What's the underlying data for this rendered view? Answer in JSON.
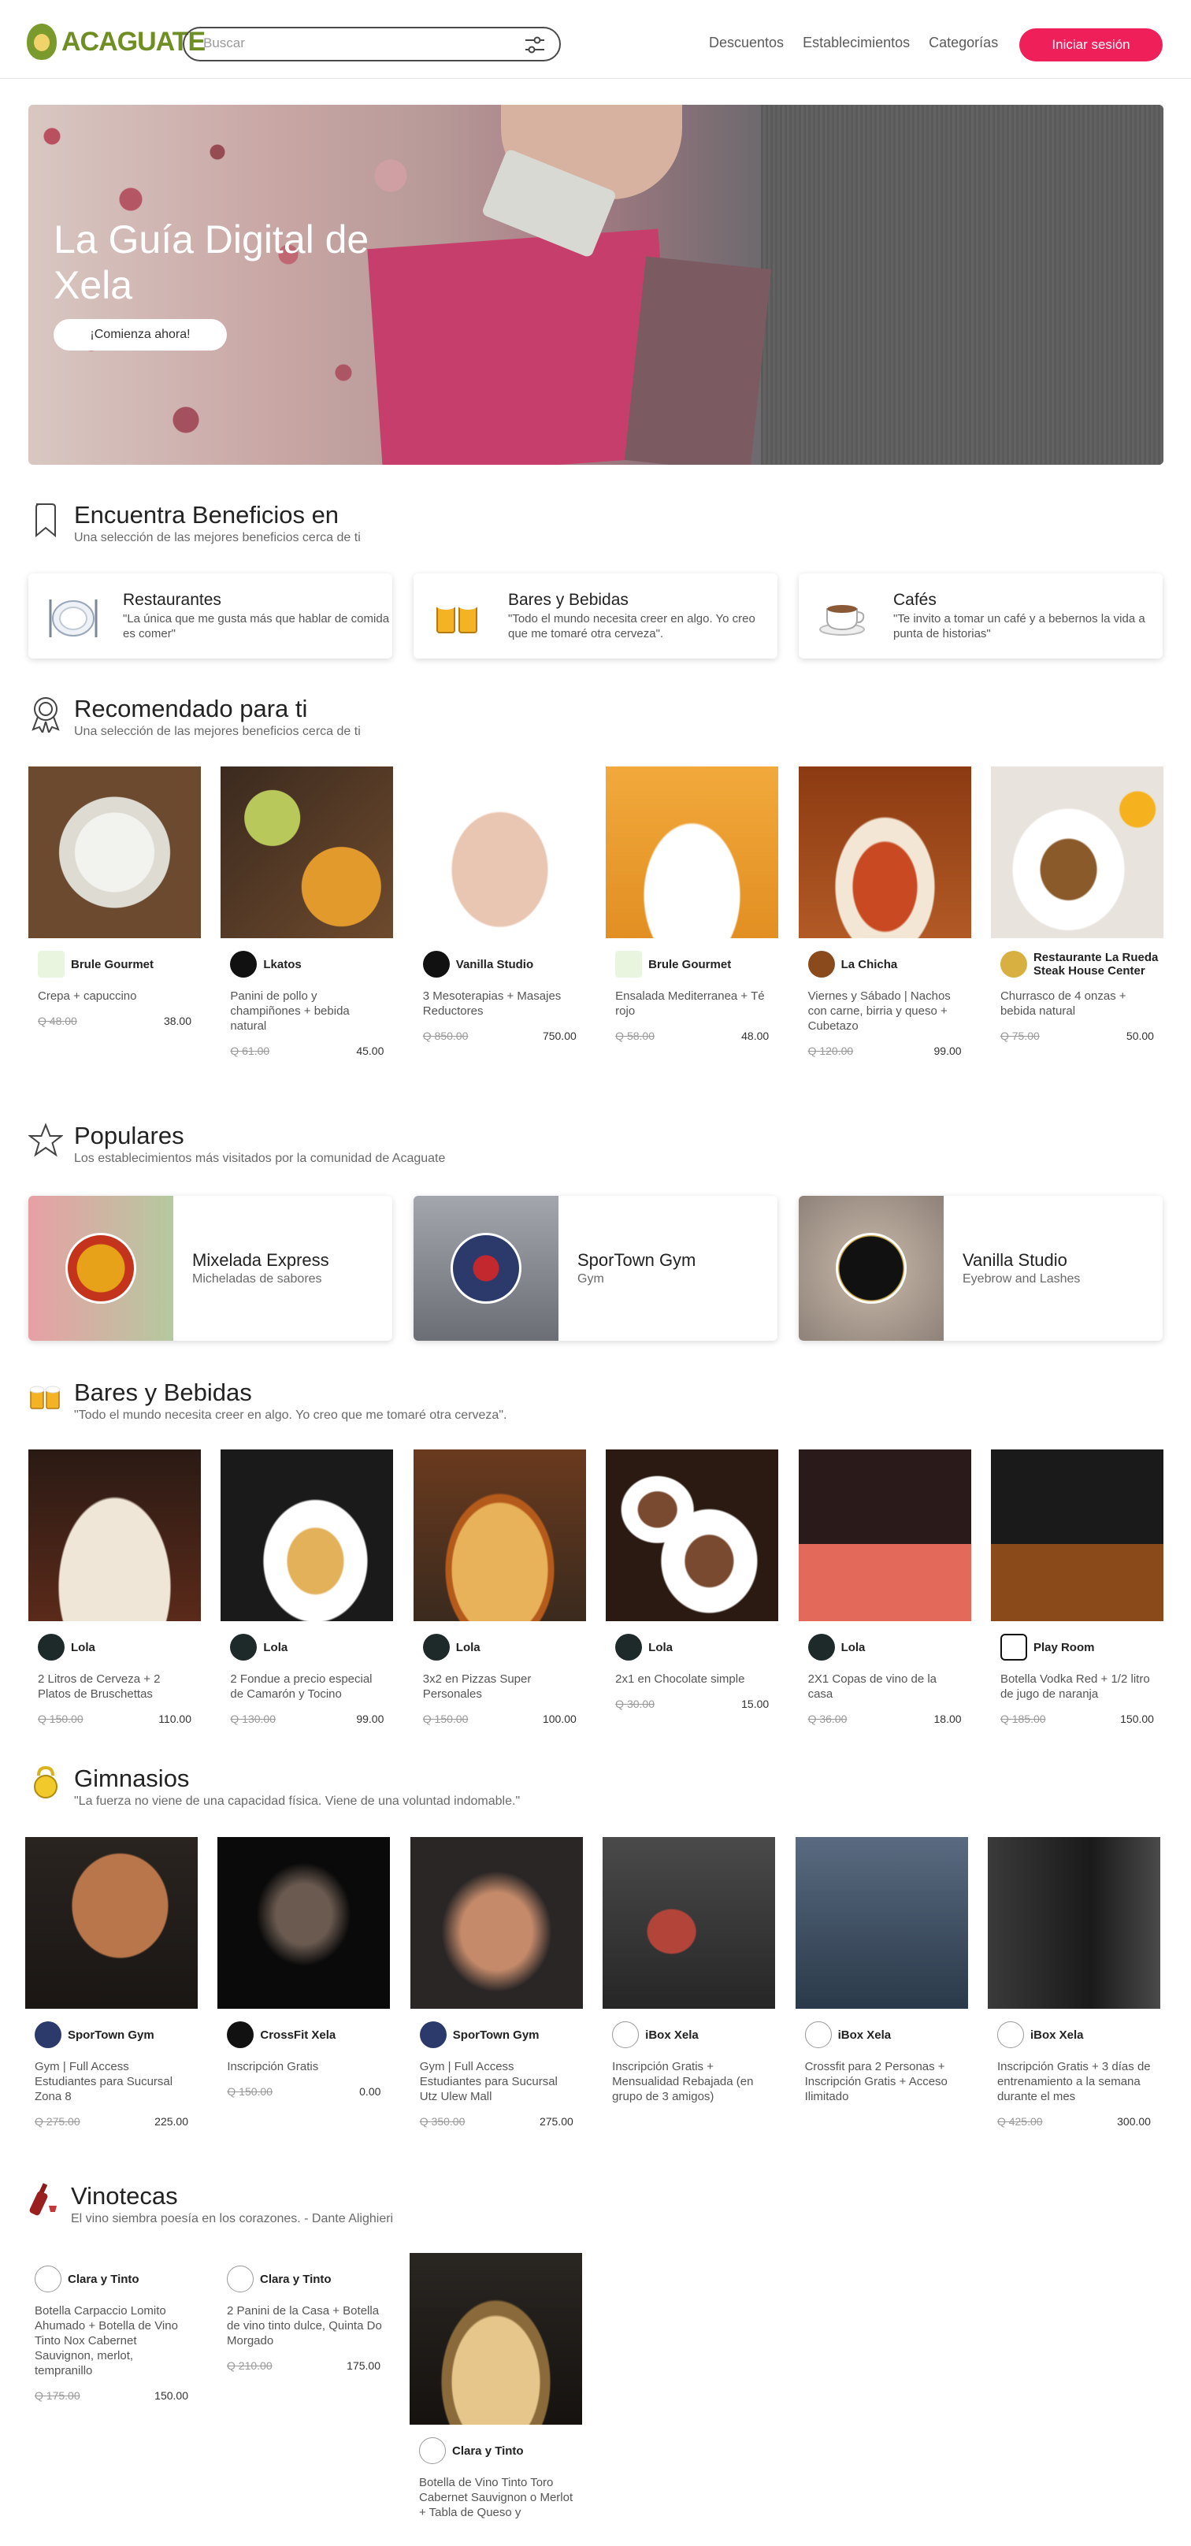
{
  "nav": {
    "brand": "ACAGUATE",
    "search_placeholder": "Buscar",
    "links": [
      "Descuentos",
      "Establecimientos",
      "Categorías"
    ],
    "login": "Iniciar sesión"
  },
  "hero": {
    "title": "La Guía Digital de Xela",
    "cta": "¡Comienza ahora!"
  },
  "benefits": {
    "title": "Encuentra Beneficios en",
    "subtitle": "Una selección de las mejores beneficios cerca de ti",
    "categories": [
      {
        "name": "Restaurantes",
        "desc": "\"La única que me gusta más que hablar de comida es comer\""
      },
      {
        "name": "Bares y Bebidas",
        "desc": "\"Todo el mundo necesita creer en algo. Yo creo que me tomaré otra cerveza\"."
      },
      {
        "name": "Cafés",
        "desc": "\"Te invito a tomar un café y a bebernos la vida a punta de historias\""
      }
    ]
  },
  "recommended": {
    "title": "Recomendado para ti",
    "subtitle": "Una selección de las mejores beneficios cerca de ti",
    "items": [
      {
        "biz": "Brule Gourmet",
        "desc": "Crepa + capuccino",
        "old": "Q 48.00",
        "new": "38.00"
      },
      {
        "biz": "Lkatos",
        "desc": "Panini de pollo y champiñones + bebida natural",
        "old": "Q 61.00",
        "new": "45.00"
      },
      {
        "biz": "Vanilla Studio",
        "desc": "3 Mesoterapias + Masajes Reductores",
        "old": "Q 850.00",
        "new": "750.00"
      },
      {
        "biz": "Brule Gourmet",
        "desc": "Ensalada Mediterranea + Té rojo",
        "old": "Q 58.00",
        "new": "48.00"
      },
      {
        "biz": "La Chicha",
        "desc": "Viernes y Sábado | Nachos con carne, birria y queso + Cubetazo",
        "old": "Q 120.00",
        "new": "99.00"
      },
      {
        "biz": "Restaurante La Rueda Steak House Center",
        "desc": "Churrasco de 4 onzas + bebida natural",
        "old": "Q 75.00",
        "new": "50.00"
      }
    ]
  },
  "popular": {
    "title": "Populares",
    "subtitle": "Los establecimientos más visitados por la comunidad de Acaguate",
    "items": [
      {
        "name": "Mixelada Express",
        "desc": "Micheladas de sabores"
      },
      {
        "name": "SporTown Gym",
        "desc": "Gym"
      },
      {
        "name": "Vanilla Studio",
        "desc": "Eyebrow and Lashes"
      }
    ]
  },
  "bars": {
    "title": "Bares y Bebidas",
    "subtitle": "\"Todo el mundo necesita creer en algo. Yo creo que me tomaré otra cerveza\".",
    "items": [
      {
        "biz": "Lola",
        "desc": "2 Litros de Cerveza + 2 Platos de Bruschettas",
        "old": "Q 150.00",
        "new": "110.00"
      },
      {
        "biz": "Lola",
        "desc": "2 Fondue a precio especial de Camarón y Tocino",
        "old": "Q 130.00",
        "new": "99.00"
      },
      {
        "biz": "Lola",
        "desc": "3x2 en Pizzas Super Personales",
        "old": "Q 150.00",
        "new": "100.00"
      },
      {
        "biz": "Lola",
        "desc": "2x1 en Chocolate simple",
        "old": "Q 30.00",
        "new": "15.00"
      },
      {
        "biz": "Lola",
        "desc": "2X1 Copas de vino de la casa",
        "old": "Q 36.00",
        "new": "18.00"
      },
      {
        "biz": "Play Room",
        "desc": "Botella Vodka Red + 1/2 litro de jugo de naranja",
        "old": "Q 185.00",
        "new": "150.00"
      }
    ]
  },
  "gyms": {
    "title": "Gimnasios",
    "subtitle": "\"La fuerza no viene de una capacidad física. Viene de una voluntad indomable.\"",
    "items": [
      {
        "biz": "SporTown Gym",
        "desc": "Gym | Full Access Estudiantes para Sucursal Zona 8",
        "old": "Q 275.00",
        "new": "225.00"
      },
      {
        "biz": "CrossFit Xela",
        "desc": "Inscripción Gratis",
        "old": "Q 150.00",
        "new": "0.00"
      },
      {
        "biz": "SporTown Gym",
        "desc": "Gym | Full Access Estudiantes para Sucursal Utz Ulew Mall",
        "old": "Q 350.00",
        "new": "275.00"
      },
      {
        "biz": "iBox Xela",
        "desc": "Inscripción Gratis + Mensualidad Rebajada (en grupo de 3 amigos)",
        "old": "",
        "new": ""
      },
      {
        "biz": "iBox Xela",
        "desc": "Crossfit para 2 Personas + Inscripción Gratis + Acceso Ilimitado",
        "old": "",
        "new": ""
      },
      {
        "biz": "iBox Xela",
        "desc": "Inscripción Gratis + 3 días de entrenamiento a la semana durante el mes",
        "old": "Q 425.00",
        "new": "300.00"
      }
    ]
  },
  "wine": {
    "title": "Vinotecas",
    "subtitle": "El vino siembra poesía en los corazones. - Dante Alighieri",
    "items": [
      {
        "biz": "Clara y Tinto",
        "desc": "Botella Carpaccio Lomito Ahumado + Botella de Vino Tinto Nox Cabernet Sauvignon, merlot, tempranillo",
        "old": "Q 175.00",
        "new": "150.00"
      },
      {
        "biz": "Clara y Tinto",
        "desc": "2 Panini de la Casa + Botella de vino tinto dulce, Quinta Do Morgado",
        "old": "Q 210.00",
        "new": "175.00"
      },
      {
        "biz": "Clara y Tinto",
        "desc": "Botella de Vino Tinto Toro Cabernet Sauvignon o Merlot + Tabla de Queso y",
        "old": "",
        "new": ""
      }
    ]
  },
  "colors": {
    "accent": "#ef1f5a",
    "brand": "#6f8f25"
  }
}
